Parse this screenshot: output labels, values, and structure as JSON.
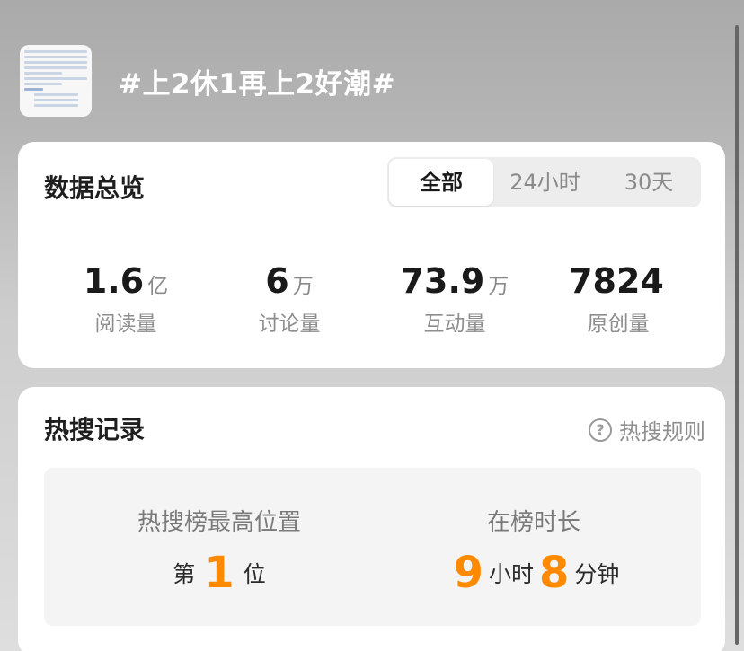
{
  "topic": {
    "title": "#上2休1再上2好潮#",
    "thumbnail_icon": "topic-thumbnail"
  },
  "overview": {
    "title": "数据总览",
    "tabs": [
      {
        "label": "全部",
        "active": true
      },
      {
        "label": "24小时",
        "active": false
      },
      {
        "label": "30天",
        "active": false
      }
    ],
    "stats": [
      {
        "value": "1.6",
        "unit": "亿",
        "label": "阅读量"
      },
      {
        "value": "6",
        "unit": "万",
        "label": "讨论量"
      },
      {
        "value": "73.9",
        "unit": "万",
        "label": "互动量"
      },
      {
        "value": "7824",
        "unit": "",
        "label": "原创量"
      }
    ]
  },
  "hot": {
    "title": "热搜记录",
    "rules_label": "热搜规则",
    "rules_icon": "question-circle-icon",
    "highest": {
      "label": "热搜榜最高位置",
      "prefix": "第",
      "value": "1",
      "suffix": "位"
    },
    "duration": {
      "label": "在榜时长",
      "hours": "9",
      "hours_unit": "小时",
      "minutes": "8",
      "minutes_unit": "分钟"
    },
    "accent_color": "#ff8a00"
  }
}
